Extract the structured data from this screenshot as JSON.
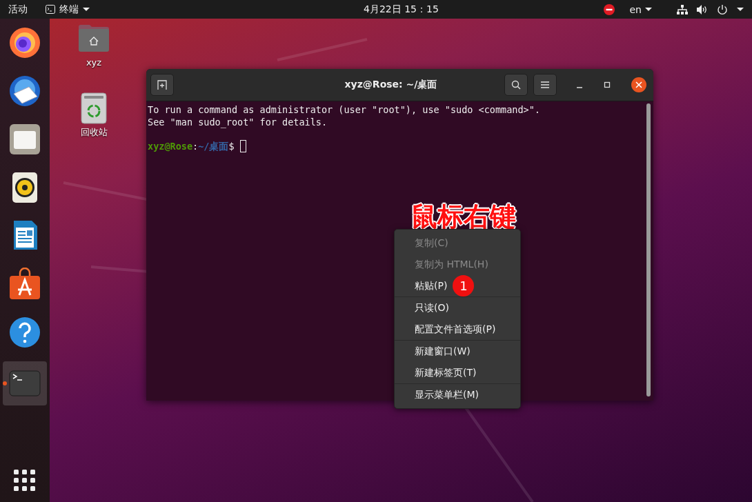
{
  "top_bar": {
    "activities": "活动",
    "app_menu": "终端",
    "clock": "4月22日 15：15",
    "keyboard": "en"
  },
  "dock": {
    "apps": [
      {
        "kind": "firefox",
        "selected": false,
        "running": false
      },
      {
        "kind": "mail",
        "selected": false,
        "running": false
      },
      {
        "kind": "files",
        "selected": false,
        "running": false
      },
      {
        "kind": "music",
        "selected": false,
        "running": false
      },
      {
        "kind": "writer",
        "selected": false,
        "running": false
      },
      {
        "kind": "store",
        "selected": false,
        "running": false
      },
      {
        "kind": "help",
        "selected": false,
        "running": false
      },
      {
        "kind": "terminal",
        "selected": true,
        "running": true
      }
    ]
  },
  "desktop": {
    "icons": [
      {
        "kind": "home",
        "label": "xyz"
      },
      {
        "kind": "trash",
        "label": "回收站"
      }
    ]
  },
  "window": {
    "title": "xyz@Rose: ~/桌面",
    "lines": [
      "To run a command as administrator (user \"root\"), use \"sudo <command>\".",
      "See \"man sudo_root\" for details."
    ],
    "prompt": {
      "user": "xyz@Rose",
      "separator": ":",
      "path": "~/桌面",
      "symbol": "$"
    }
  },
  "annotation": "鼠标右键",
  "context_menu": {
    "groups": [
      [
        {
          "label": "复制(C)",
          "disabled": true
        },
        {
          "label": "复制为 HTML(H)",
          "disabled": true
        },
        {
          "label": "粘贴(P)",
          "disabled": false,
          "badge": "1"
        }
      ],
      [
        {
          "label": "只读(O)",
          "disabled": false
        },
        {
          "label": "配置文件首选项(P)",
          "disabled": false
        }
      ],
      [
        {
          "label": "新建窗口(W)",
          "disabled": false
        },
        {
          "label": "新建标签页(T)",
          "disabled": false
        }
      ],
      [
        {
          "label": "显示菜单栏(M)",
          "disabled": false
        }
      ]
    ]
  }
}
